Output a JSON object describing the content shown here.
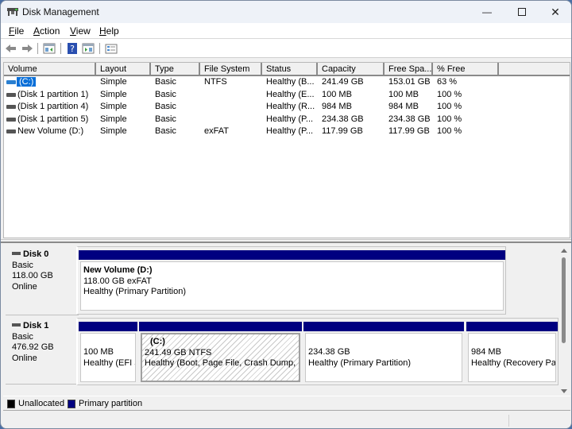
{
  "window": {
    "title": "Disk Management",
    "minimize_glyph": "—",
    "maximize_glyph": "☐",
    "close_glyph": "✕"
  },
  "menu": [
    {
      "label": "File",
      "accel": "F"
    },
    {
      "label": "Action",
      "accel": "A"
    },
    {
      "label": "View",
      "accel": "V"
    },
    {
      "label": "Help",
      "accel": "H"
    }
  ],
  "toolbar": {
    "buttons": [
      "back-icon",
      "forward-icon",
      "show-hide-console-tree-icon",
      "help-icon",
      "show-hide-action-pane-icon",
      "properties-icon"
    ]
  },
  "volume_list": {
    "columns": [
      "Volume",
      "Layout",
      "Type",
      "File System",
      "Status",
      "Capacity",
      "Free Spa...",
      "% Free"
    ],
    "rows": [
      {
        "volume": "(C:)",
        "layout": "Simple",
        "type": "Basic",
        "fs": "NTFS",
        "status": "Healthy (B...",
        "capacity": "241.49 GB",
        "free": "153.01 GB",
        "pct": "63 %",
        "selected": true
      },
      {
        "volume": "(Disk 1 partition 1)",
        "layout": "Simple",
        "type": "Basic",
        "fs": "",
        "status": "Healthy (E...",
        "capacity": "100 MB",
        "free": "100 MB",
        "pct": "100 %",
        "selected": false
      },
      {
        "volume": "(Disk 1 partition 4)",
        "layout": "Simple",
        "type": "Basic",
        "fs": "",
        "status": "Healthy (R...",
        "capacity": "984 MB",
        "free": "984 MB",
        "pct": "100 %",
        "selected": false
      },
      {
        "volume": "(Disk 1 partition 5)",
        "layout": "Simple",
        "type": "Basic",
        "fs": "",
        "status": "Healthy (P...",
        "capacity": "234.38 GB",
        "free": "234.38 GB",
        "pct": "100 %",
        "selected": false
      },
      {
        "volume": "New Volume (D:)",
        "layout": "Simple",
        "type": "Basic",
        "fs": "exFAT",
        "status": "Healthy (P...",
        "capacity": "117.99 GB",
        "free": "117.99 GB",
        "pct": "100 %",
        "selected": false
      }
    ]
  },
  "disks": [
    {
      "name": "Disk 0",
      "type": "Basic",
      "size": "118.00 GB",
      "state": "Online",
      "partitions": [
        {
          "name": "New Volume  (D:)",
          "line1": "118.00 GB exFAT",
          "line2": "Healthy (Primary Partition)"
        }
      ]
    },
    {
      "name": "Disk 1",
      "type": "Basic",
      "size": "476.92 GB",
      "state": "Online",
      "partitions": [
        {
          "name": "",
          "line1": "100 MB",
          "line2": "Healthy (EFI System Partition)"
        },
        {
          "name": "(C:)",
          "line1": "241.49 GB NTFS",
          "line2": "Healthy (Boot, Page File, Crash Dump, Basic Data Partition)"
        },
        {
          "name": "",
          "line1": "234.38 GB",
          "line2": "Healthy (Primary Partition)"
        },
        {
          "name": "",
          "line1": "984 MB",
          "line2": "Healthy (Recovery Partition)"
        }
      ]
    }
  ],
  "legend": [
    {
      "label": "Unallocated",
      "color": "#000000"
    },
    {
      "label": "Primary partition",
      "color": "#000080"
    }
  ]
}
